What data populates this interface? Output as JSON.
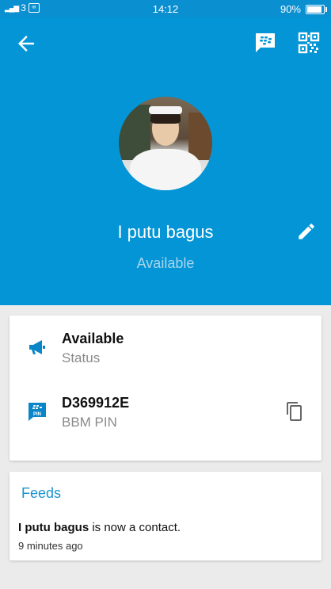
{
  "status_bar": {
    "network": "3",
    "time": "14:12",
    "battery_text": "90%",
    "battery_level": 0.9
  },
  "header": {
    "bg_color": "#0395d6",
    "name": "I putu bagus",
    "status": "Available",
    "icons": [
      "back-arrow-icon",
      "bbm-chat-icon",
      "qr-code-icon",
      "edit-pencil-icon"
    ]
  },
  "info_card": {
    "status_value": "Available",
    "status_label": "Status",
    "pin_value": "D369912E",
    "pin_label": "BBM PIN",
    "pin_icon_text": "PIN",
    "accent_color": "#0a86c8"
  },
  "feeds": {
    "title": "Feeds",
    "items": [
      {
        "name": "I putu bagus",
        "text": " is now a contact.",
        "time": "9 minutes ago"
      }
    ]
  }
}
